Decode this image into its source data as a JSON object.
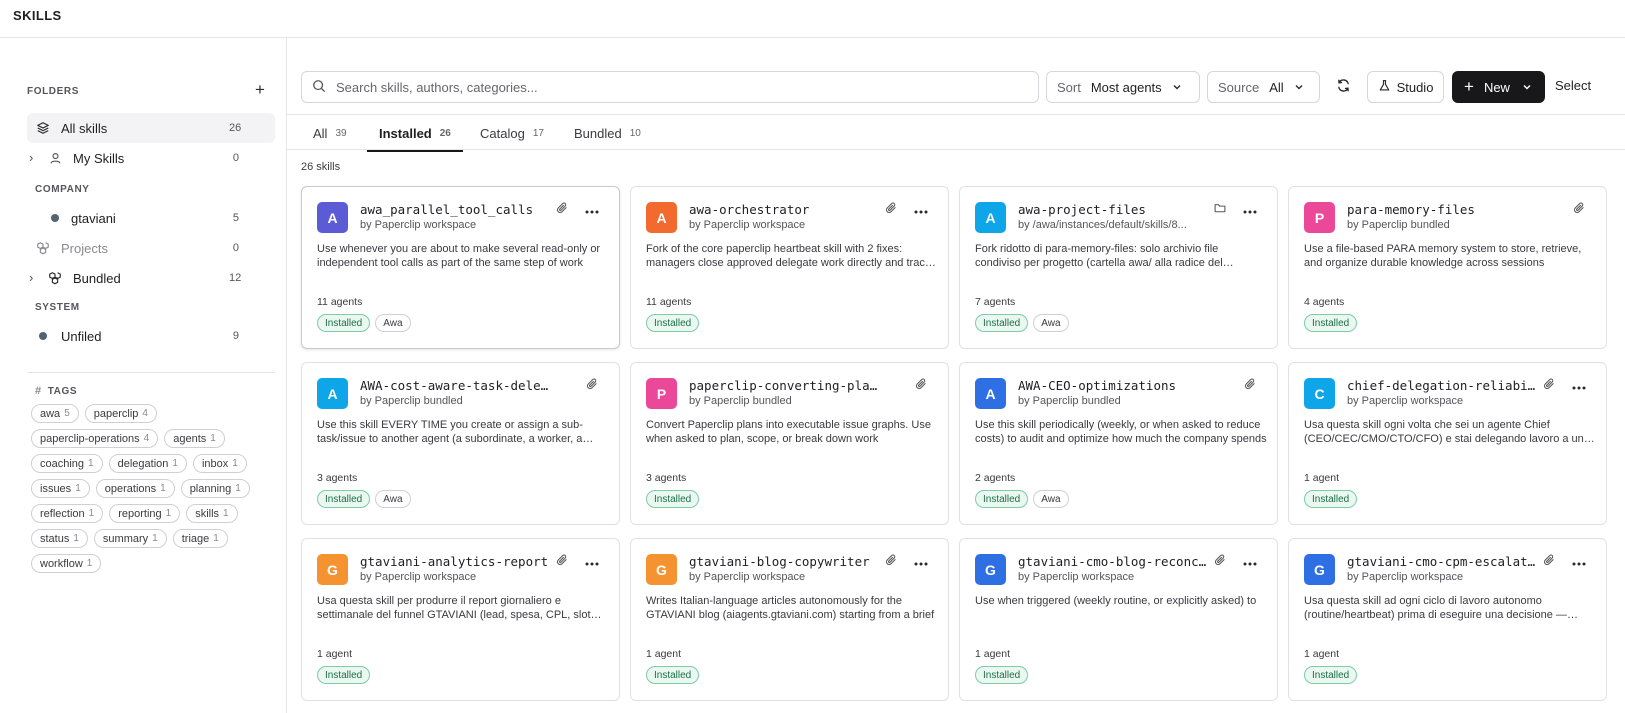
{
  "app": {
    "title": "SKILLS"
  },
  "sidebar": {
    "folders_heading": "FOLDERS",
    "all_skills": {
      "label": "All skills",
      "count": "26"
    },
    "my_skills": {
      "label": "My Skills",
      "count": "0"
    },
    "company_heading": "COMPANY",
    "gtaviani": {
      "label": "gtaviani",
      "count": "5"
    },
    "projects": {
      "label": "Projects",
      "count": "0"
    },
    "bundled": {
      "label": "Bundled",
      "count": "12"
    },
    "system_heading": "SYSTEM",
    "unfiled": {
      "label": "Unfiled",
      "count": "9"
    },
    "tags_heading": "TAGS",
    "tags": [
      {
        "name": "awa",
        "count": "5"
      },
      {
        "name": "paperclip",
        "count": "4"
      },
      {
        "name": "paperclip-operations",
        "count": "4"
      },
      {
        "name": "agents",
        "count": "1"
      },
      {
        "name": "coaching",
        "count": "1"
      },
      {
        "name": "delegation",
        "count": "1"
      },
      {
        "name": "inbox",
        "count": "1"
      },
      {
        "name": "issues",
        "count": "1"
      },
      {
        "name": "operations",
        "count": "1"
      },
      {
        "name": "planning",
        "count": "1"
      },
      {
        "name": "reflection",
        "count": "1"
      },
      {
        "name": "reporting",
        "count": "1"
      },
      {
        "name": "skills",
        "count": "1"
      },
      {
        "name": "status",
        "count": "1"
      },
      {
        "name": "summary",
        "count": "1"
      },
      {
        "name": "triage",
        "count": "1"
      },
      {
        "name": "workflow",
        "count": "1"
      }
    ]
  },
  "toolbar": {
    "search_placeholder": "Search skills, authors, categories...",
    "sort_label": "Sort",
    "sort_value": "Most agents",
    "source_label": "Source",
    "source_value": "All",
    "studio_label": "Studio",
    "new_label": "New",
    "select_label": "Select"
  },
  "tabs": [
    {
      "label": "All",
      "count": "39"
    },
    {
      "label": "Installed",
      "count": "26"
    },
    {
      "label": "Catalog",
      "count": "17"
    },
    {
      "label": "Bundled",
      "count": "10"
    }
  ],
  "results_count": "26 skills",
  "colors": {
    "avatar_indigo": "#5b5bd6",
    "avatar_orange": "#f26a2e",
    "avatar_sky": "#0ea5e9",
    "avatar_pink": "#ec4899",
    "avatar_blue": "#2f6fe4",
    "avatar_amber": "#f59331"
  },
  "cards": [
    {
      "letter": "A",
      "name": "awa_parallel_tool_calls",
      "author": "by Paperclip workspace",
      "desc": "Use whenever you are about to make several read-only or independent tool calls as part of the same step of work",
      "agents": "11 agents",
      "badge": "Installed",
      "tag": "Awa",
      "icon": "paperclip-icon",
      "more": true
    },
    {
      "letter": "A",
      "name": "awa-orchestrator",
      "author": "by Paperclip workspace",
      "desc": "Fork of the core paperclip heartbeat skill with 2 fixes: managers close approved delegate work directly and track it",
      "agents": "11 agents",
      "badge": "Installed",
      "tag": "",
      "icon": "paperclip-icon",
      "more": true
    },
    {
      "letter": "A",
      "name": "awa-project-files",
      "author": "by /awa/instances/default/skills/8...",
      "desc": "Fork ridotto di para-memory-files: solo archivio file condiviso per progetto (cartella awa/ alla radice del progetto)",
      "agents": "7 agents",
      "badge": "Installed",
      "tag": "Awa",
      "icon": "folder-icon",
      "more": true
    },
    {
      "letter": "P",
      "name": "para-memory-files",
      "author": "by Paperclip bundled",
      "desc": "Use a file-based PARA memory system to store, retrieve, and organize durable knowledge across sessions",
      "agents": "4 agents",
      "badge": "Installed",
      "tag": "",
      "icon": "paperclip-icon",
      "more": false
    },
    {
      "letter": "A",
      "name": "AWA-cost-aware-task-delegation",
      "author": "by Paperclip bundled",
      "desc": "Use this skill EVERY TIME you create or assign a sub-task/issue to another agent (a subordinate, a worker, a peer)",
      "agents": "3 agents",
      "badge": "Installed",
      "tag": "Awa",
      "icon": "paperclip-icon",
      "more": false
    },
    {
      "letter": "P",
      "name": "paperclip-converting-plans-to-tasks",
      "author": "by Paperclip bundled",
      "desc": "Convert Paperclip plans into executable issue graphs. Use when asked to plan, scope, or break down work",
      "agents": "3 agents",
      "badge": "Installed",
      "tag": "",
      "icon": "paperclip-icon",
      "more": false
    },
    {
      "letter": "A",
      "name": "AWA-CEO-optimizations",
      "author": "by Paperclip bundled",
      "desc": "Use this skill periodically (weekly, or when asked to reduce costs) to audit and optimize how much the company spends",
      "agents": "2 agents",
      "badge": "Installed",
      "tag": "Awa",
      "icon": "paperclip-icon",
      "more": false
    },
    {
      "letter": "C",
      "name": "chief-delegation-reliability",
      "author": "by Paperclip workspace",
      "desc": "Usa questa skill ogni volta che sei un agente Chief (CEO/CEC/CMO/CTO/CFO) e stai delegando lavoro a un subordinato",
      "agents": "1 agent",
      "badge": "Installed",
      "tag": "",
      "icon": "paperclip-icon",
      "more": true
    },
    {
      "letter": "G",
      "name": "gtaviani-analytics-report",
      "author": "by Paperclip workspace",
      "desc": "Usa questa skill per produrre il report giornaliero e settimanale del funnel GTAVIANI (lead, spesa, CPL, slot prenotati)",
      "agents": "1 agent",
      "badge": "Installed",
      "tag": "",
      "icon": "paperclip-icon",
      "more": true
    },
    {
      "letter": "G",
      "name": "gtaviani-blog-copywriter",
      "author": "by Paperclip workspace",
      "desc": "Writes Italian-language articles autonomously for the GTAVIANI blog (aiagents.gtaviani.com) starting from a brief",
      "agents": "1 agent",
      "badge": "Installed",
      "tag": "",
      "icon": "paperclip-icon",
      "more": true
    },
    {
      "letter": "G",
      "name": "gtaviani-cmo-blog-reconciliation",
      "author": "by Paperclip workspace",
      "desc": "Use when triggered (weekly routine, or explicitly asked) to",
      "agents": "1 agent",
      "badge": "Installed",
      "tag": "",
      "icon": "paperclip-icon",
      "more": true
    },
    {
      "letter": "G",
      "name": "gtaviani-cmo-cpm-escalation",
      "author": "by Paperclip workspace",
      "desc": "Usa questa skill ad ogni ciclo di lavoro autonomo (routine/heartbeat) prima di eseguire una decisione — verifica il CPM",
      "agents": "1 agent",
      "badge": "Installed",
      "tag": "",
      "icon": "paperclip-icon",
      "more": true
    }
  ]
}
